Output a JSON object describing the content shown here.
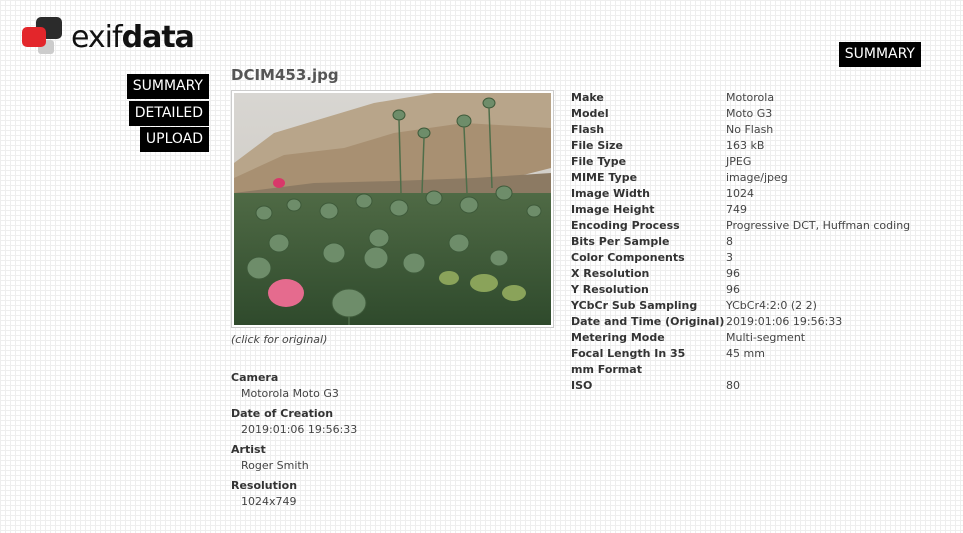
{
  "brand": {
    "name_light": "exif",
    "name_bold": "data"
  },
  "nav": {
    "top_summary": "SUMMARY",
    "side": [
      "SUMMARY",
      "DETAILED",
      "UPLOAD"
    ]
  },
  "file": {
    "name": "DCIM453.jpg",
    "caption": "(click for original)"
  },
  "summary": [
    {
      "label": "Camera",
      "value": "Motorola Moto G3"
    },
    {
      "label": "Date of Creation",
      "value": "2019:01:06 19:56:33"
    },
    {
      "label": "Artist",
      "value": "Roger Smith"
    },
    {
      "label": "Resolution",
      "value": "1024x749"
    }
  ],
  "exif": [
    {
      "key": "Make",
      "value": "Motorola"
    },
    {
      "key": "Model",
      "value": "Moto G3"
    },
    {
      "key": "Flash",
      "value": "No Flash"
    },
    {
      "key": "File Size",
      "value": "163 kB"
    },
    {
      "key": "File Type",
      "value": "JPEG"
    },
    {
      "key": "MIME Type",
      "value": "image/jpeg"
    },
    {
      "key": "Image Width",
      "value": "1024"
    },
    {
      "key": "Image Height",
      "value": "749"
    },
    {
      "key": "Encoding Process",
      "value": "Progressive DCT, Huffman coding"
    },
    {
      "key": "Bits Per Sample",
      "value": "8"
    },
    {
      "key": "Color Components",
      "value": "3"
    },
    {
      "key": "X Resolution",
      "value": "96"
    },
    {
      "key": "Y Resolution",
      "value": "96"
    },
    {
      "key": "YCbCr Sub Sampling",
      "value": "YCbCr4:2:0 (2 2)"
    },
    {
      "key": "Date and Time (Original)",
      "value": "2019:01:06 19:56:33"
    },
    {
      "key": "Metering Mode",
      "value": "Multi-segment"
    },
    {
      "key": "Focal Length In 35 mm Format",
      "value": "45 mm"
    },
    {
      "key": "ISO",
      "value": "80"
    }
  ],
  "colors": {
    "brand_red": "#e3262b",
    "brand_dark": "#2b2b2b",
    "button_bg": "#000000"
  }
}
